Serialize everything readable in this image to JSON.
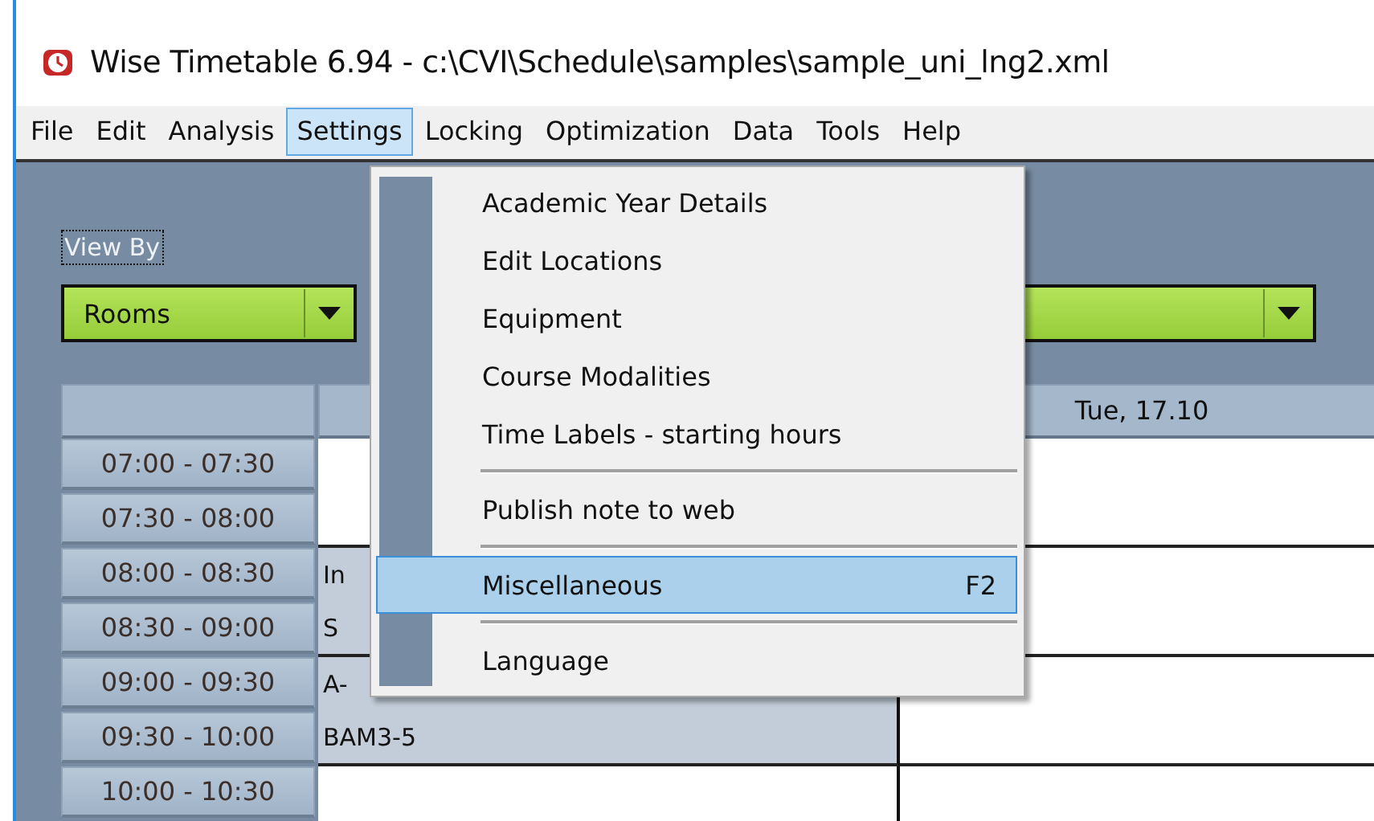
{
  "window": {
    "title": "Wise Timetable 6.94 - c:\\CVI\\Schedule\\samples\\sample_uni_lng2.xml"
  },
  "menu_bar": [
    {
      "label": "File",
      "selected": false
    },
    {
      "label": "Edit",
      "selected": false
    },
    {
      "label": "Analysis",
      "selected": false
    },
    {
      "label": "Settings",
      "selected": true
    },
    {
      "label": "Locking",
      "selected": false
    },
    {
      "label": "Optimization",
      "selected": false
    },
    {
      "label": "Data",
      "selected": false
    },
    {
      "label": "Tools",
      "selected": false
    },
    {
      "label": "Help",
      "selected": false
    }
  ],
  "view_by": {
    "label": "View By",
    "value": "Rooms"
  },
  "timetable": {
    "columns": [
      {},
      {
        "label": "Tue, 17.10"
      }
    ],
    "rows": [
      {
        "time": "07:00 - 07:30",
        "cells": [
          {
            "booked": false
          },
          {
            "booked": false
          }
        ]
      },
      {
        "time": "07:30 - 08:00",
        "cells": [
          {
            "booked": false
          },
          {
            "booked": false
          }
        ]
      },
      {
        "time": "08:00 - 08:30",
        "cells": [
          {
            "booked": true,
            "text": "In"
          },
          {
            "booked": false
          }
        ]
      },
      {
        "time": "08:30 - 09:00",
        "cells": [
          {
            "booked": true,
            "text": "S"
          },
          {
            "booked": false
          }
        ]
      },
      {
        "time": "09:00 - 09:30",
        "cells": [
          {
            "booked": true,
            "text": "A-"
          },
          {
            "booked": false
          }
        ]
      },
      {
        "time": "09:30 - 10:00",
        "cells": [
          {
            "booked": true,
            "text": "BAM3-5"
          },
          {
            "booked": false
          }
        ]
      },
      {
        "time": "10:00 - 10:30",
        "cells": [
          {
            "booked": false
          },
          {
            "booked": false
          }
        ]
      }
    ]
  },
  "settings_menu": [
    {
      "kind": "item",
      "label": "Academic Year Details",
      "selected": false
    },
    {
      "kind": "item",
      "label": "Edit Locations",
      "selected": false
    },
    {
      "kind": "item",
      "label": "Equipment",
      "selected": false
    },
    {
      "kind": "item",
      "label": "Course Modalities",
      "selected": false
    },
    {
      "kind": "item",
      "label": "Time Labels - starting hours",
      "selected": false
    },
    {
      "kind": "separator"
    },
    {
      "kind": "item",
      "label": "Publish note to web",
      "selected": false
    },
    {
      "kind": "separator"
    },
    {
      "kind": "item",
      "label": "Miscellaneous",
      "shortcut": "F2",
      "selected": true
    },
    {
      "kind": "separator"
    },
    {
      "kind": "item",
      "label": "Language",
      "selected": false
    }
  ]
}
